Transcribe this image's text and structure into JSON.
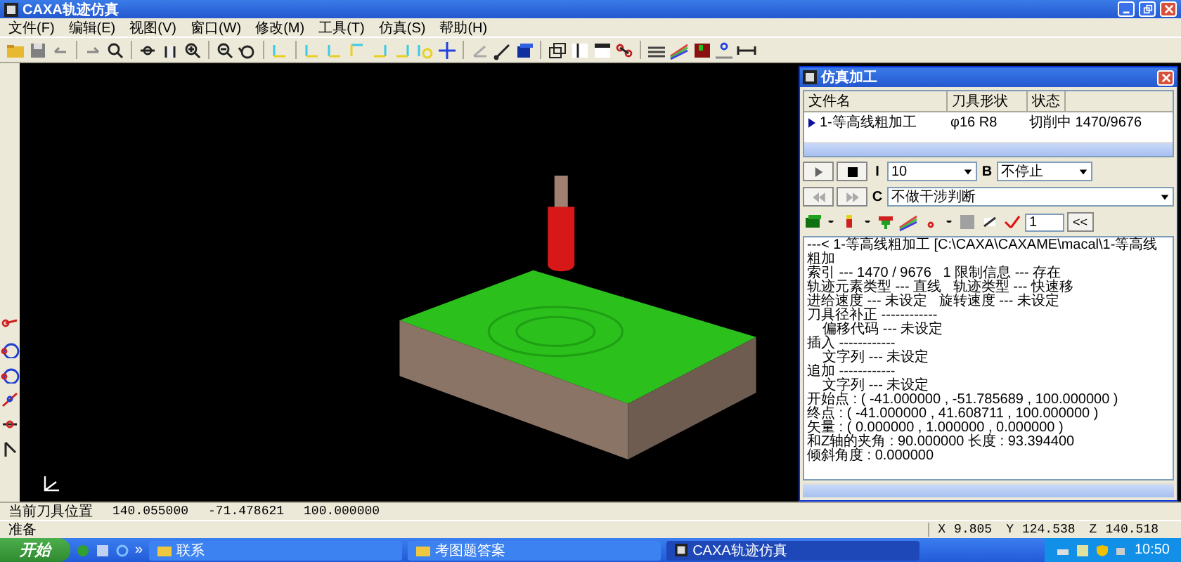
{
  "window": {
    "title": "CAXA轨迹仿真"
  },
  "menu": [
    "文件(F)",
    "编辑(E)",
    "视图(V)",
    "窗口(W)",
    "修改(M)",
    "工具(T)",
    "仿真(S)",
    "帮助(H)"
  ],
  "sim_dialog": {
    "title": "仿真加工",
    "columns": [
      "文件名",
      "刀具形状",
      "状态"
    ],
    "rows": [
      {
        "cells": [
          "1-等高线粗加工",
          "φ16 R8",
          "切削中 1470/9676"
        ],
        "selected": true
      }
    ],
    "buttons": [
      {
        "kind": "play",
        "disabled": false
      },
      {
        "kind": "stop",
        "disabled": false
      },
      {
        "kind": "rewind",
        "disabled": true
      },
      {
        "kind": "forward",
        "disabled": true
      }
    ],
    "speed_label": "I",
    "speed": "10",
    "break_label": "B",
    "break_mode": "不停止",
    "check_label": "C",
    "check_mode": "不做干涉判断",
    "step": "1",
    "back_button": "<<",
    "log": [
      "---< 1-等高线粗加工 [C:\\CAXA\\CAXAME\\macal\\1-等高线粗加",
      "索引 --- 1470 / 9676   1 限制信息 --- 存在",
      "轨迹元素类型 --- 直线   轨迹类型 --- 快速移",
      "进给速度 --- 未设定   旋转速度 --- 未设定",
      "刀具径补正 ------------",
      "    偏移代码 --- 未设定",
      "插入 ------------",
      "    文字列 --- 未设定",
      "追加 ------------",
      "    文字列 --- 未设定",
      "开始点 : ( -41.000000 , -51.785689 , 100.000000 )",
      "终点 : ( -41.000000 , 41.608711 , 100.000000 )",
      "矢量 : ( 0.000000 , 1.000000 , 0.000000 )",
      "和Z轴的夹角 : 90.000000 长度 : 93.394400",
      "倾斜角度 : 0.000000"
    ]
  },
  "status": {
    "label": "当前刀具位置",
    "values": [
      "140.055000",
      "-71.478621",
      "100.000000"
    ],
    "message": "准备",
    "coords": [
      {
        "axis": "X",
        "value": "9.805"
      },
      {
        "axis": "Y",
        "value": "124.538"
      },
      {
        "axis": "Z",
        "value": "140.518"
      }
    ]
  },
  "taskbar": {
    "start": "开始",
    "more": "»",
    "tasks": [
      {
        "label": "联系",
        "kind": "folder",
        "selected": false
      },
      {
        "label": "考图题答案",
        "kind": "folder",
        "selected": false
      },
      {
        "label": "CAXA轨迹仿真",
        "kind": "app",
        "selected": true
      }
    ],
    "clock": "10:50"
  }
}
